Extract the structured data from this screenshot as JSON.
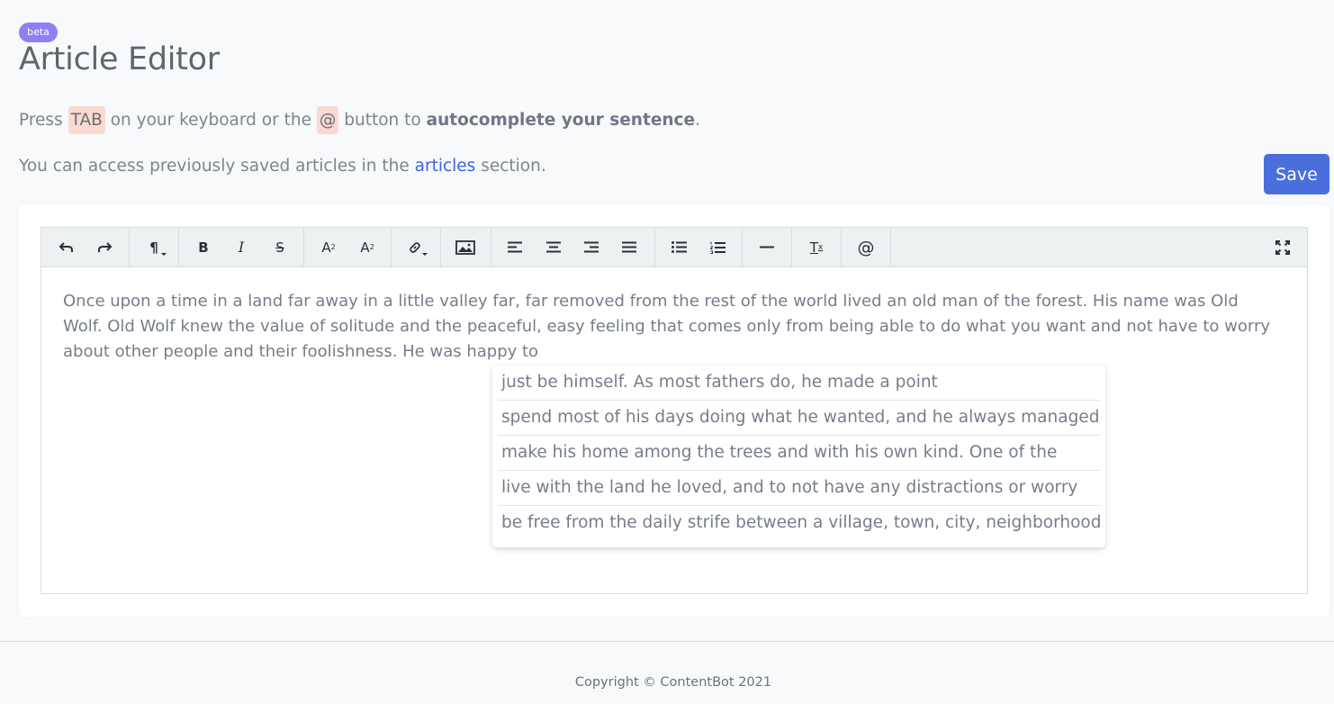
{
  "header": {
    "badge": "beta",
    "title": "Article Editor"
  },
  "intro": {
    "press": "Press",
    "tab_key": "TAB",
    "on_keyboard": "on your keyboard or the",
    "at_key": "@",
    "button_to": "button to",
    "autocomplete": "autocomplete your sentence",
    "period": "."
  },
  "info": {
    "before": "You can access previously saved articles in the",
    "link": "articles",
    "after": "section."
  },
  "actions": {
    "save_label": "Save"
  },
  "toolbar": {
    "buttons": [
      "undo-icon",
      "redo-icon",
      "paragraph-icon",
      "bold-icon",
      "italic-icon",
      "strikethrough-icon",
      "superscript-icon",
      "subscript-icon",
      "link-icon",
      "image-icon",
      "align-left-icon",
      "align-center-icon",
      "align-right-icon",
      "justify-icon",
      "bullet-list-icon",
      "numbered-list-icon",
      "horizontal-rule-icon",
      "clear-format-icon",
      "at-icon",
      "fullscreen-icon"
    ],
    "glyphs": {
      "paragraph": "¶",
      "bold": "B",
      "italic": "I",
      "strike": "S",
      "sup_base": "A",
      "sup_mark": "2",
      "sub_base": "A",
      "sub_mark": "2",
      "clear_base": "T",
      "clear_mark": "x",
      "at": "@"
    }
  },
  "editor": {
    "text": "Once upon a time in a land far away in a little valley far, far removed from the rest of the world lived an old man of the forest. His name was Old Wolf. Old Wolf knew the value of solitude and the peaceful, easy feeling that comes only from being able to do what you want and not have to worry about other people and their foolishness. He was happy to"
  },
  "suggestions": [
    "just be himself. As most fathers do, he made a point",
    "spend most of his days doing what he wanted, and he always managed to",
    "make his home among the trees and with his own kind. One of the",
    "live with the land he loved, and to not have any distractions or worry",
    "be free from the daily strife between a village, town, city, neighborhood"
  ],
  "footer": {
    "copyright": "Copyright © ContentBot 2021"
  }
}
